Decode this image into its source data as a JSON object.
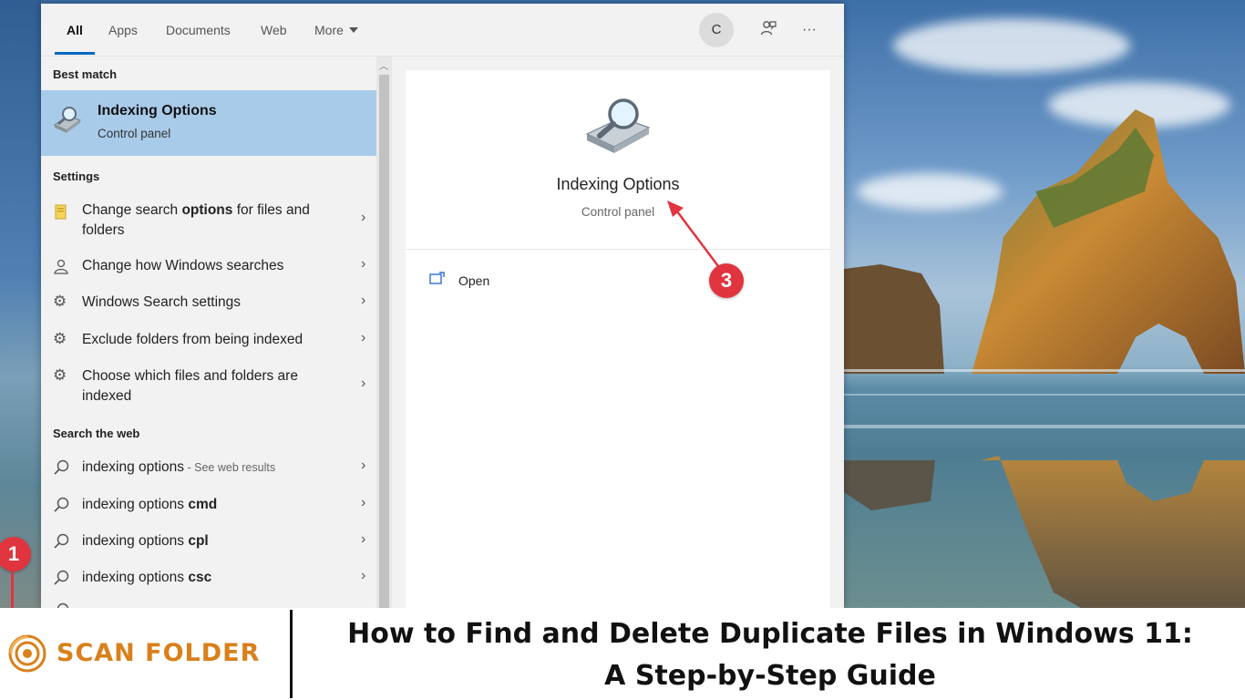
{
  "search_panel": {
    "tabs": [
      {
        "label": "All"
      },
      {
        "label": "Apps"
      },
      {
        "label": "Documents"
      },
      {
        "label": "Web"
      },
      {
        "label": "More"
      }
    ],
    "user_initial": "C",
    "more_options_glyph": "···",
    "results": {
      "best_match_heading": "Best match",
      "best_match": {
        "title": "Indexing Options",
        "subtitle": "Control panel",
        "icon": "indexing-options-icon"
      },
      "settings_heading": "Settings",
      "settings": [
        {
          "icon": "folder-options-icon",
          "pre": "Change search ",
          "bold": "options",
          "post": " for files and folders"
        },
        {
          "icon": "user-search-icon",
          "pre": "Change how Windows searches",
          "bold": "",
          "post": ""
        },
        {
          "icon": "gear-icon",
          "pre": "Windows Search settings",
          "bold": "",
          "post": ""
        },
        {
          "icon": "gear-icon",
          "pre": "Exclude folders from being indexed",
          "bold": "",
          "post": ""
        },
        {
          "icon": "gear-icon",
          "pre": "Choose which files and folders are indexed",
          "bold": "",
          "post": ""
        }
      ],
      "web_heading": "Search the web",
      "web": [
        {
          "pre": "indexing options",
          "bold": "",
          "muted": " - See web results"
        },
        {
          "pre": "indexing options ",
          "bold": "cmd",
          "muted": ""
        },
        {
          "pre": "indexing options ",
          "bold": "cpl",
          "muted": ""
        },
        {
          "pre": "indexing options ",
          "bold": "csc",
          "muted": ""
        }
      ]
    },
    "preview": {
      "title": "Indexing Options",
      "subtitle": "Control panel",
      "open_label": "Open"
    }
  },
  "annotations": {
    "step_1": "1",
    "step_3": "3",
    "color": "#e0343f"
  },
  "banner": {
    "brand": "SCAN FOLDER",
    "brand_color": "#d9801b",
    "headline_line1": "How to Find and Delete Duplicate Files in Windows 11:",
    "headline_line2": "A Step-by-Step Guide"
  }
}
